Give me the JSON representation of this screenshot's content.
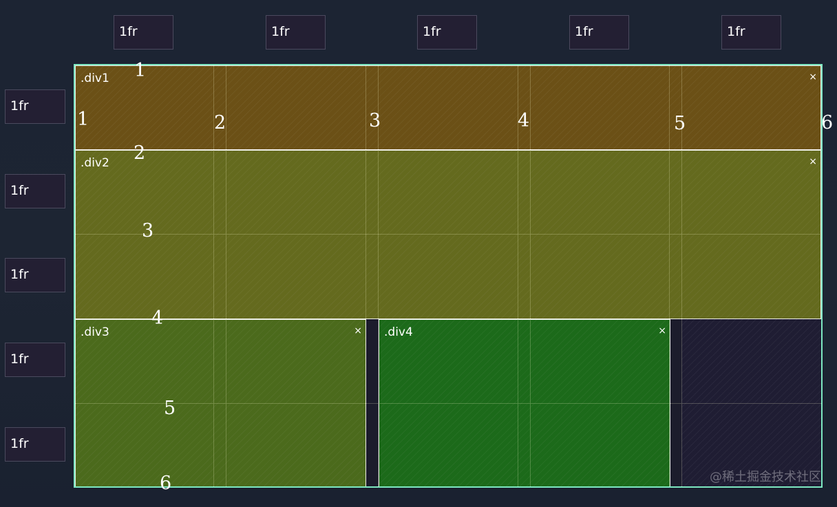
{
  "column_tracks": [
    "1fr",
    "1fr",
    "1fr",
    "1fr",
    "1fr"
  ],
  "row_tracks": [
    "1fr",
    "1fr",
    "1fr",
    "1fr",
    "1fr"
  ],
  "areas": {
    "div1": {
      "label": ".div1",
      "close": "×",
      "color": "#6b5016"
    },
    "div2": {
      "label": ".div2",
      "close": "×",
      "color": "#646a1e"
    },
    "div3": {
      "label": ".div3",
      "close": "×",
      "color": "#4b6a1c"
    },
    "div4": {
      "label": ".div4",
      "close": "×",
      "color": "#1c6a1a"
    }
  },
  "column_line_numbers": [
    "1",
    "2",
    "3",
    "4",
    "5",
    "6"
  ],
  "row_line_numbers": [
    "1",
    "2",
    "3",
    "4",
    "5",
    "6"
  ],
  "colors": {
    "grid_outline": "#7de8c1",
    "empty_cell": "#1c1c2c",
    "track_box": "#231f33"
  },
  "watermark": "@稀土掘金技术社区"
}
